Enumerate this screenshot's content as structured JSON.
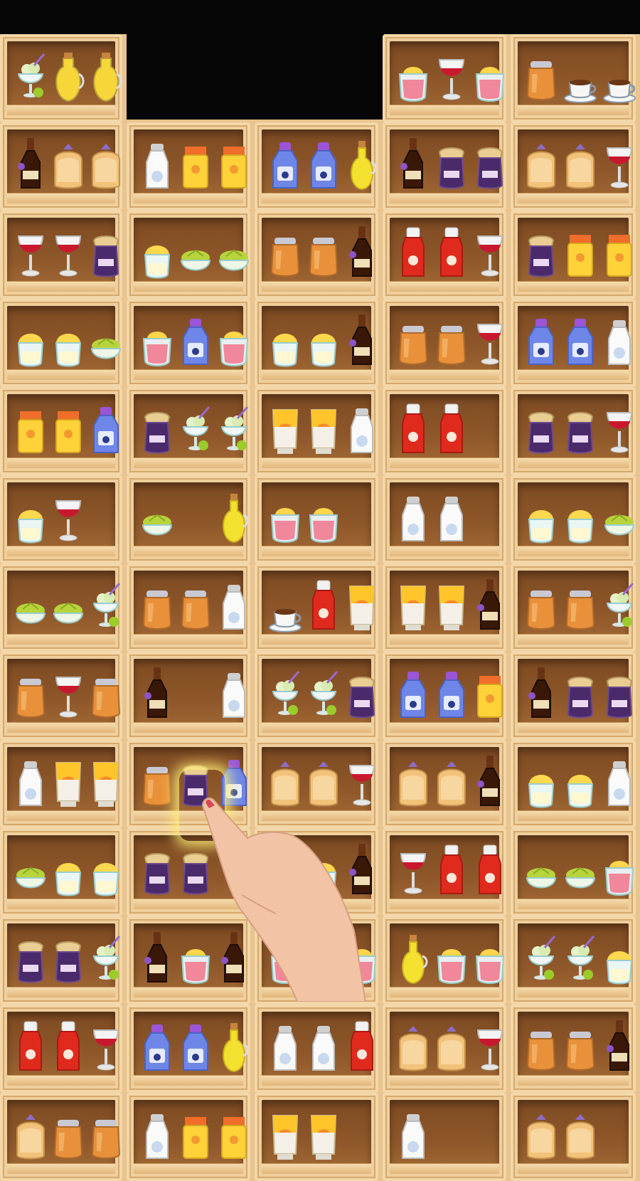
{
  "game": {
    "shelf_columns": 5,
    "item_types": [
      "lemon-cup-jar",
      "wine-glass",
      "juice-cruet",
      "coffee-cup",
      "honey-jar",
      "milk-bottle",
      "jam-jar",
      "bread-loaf",
      "orange-carton",
      "blue-bottle",
      "olive-oil-bottle",
      "lime-juicer",
      "pink-juice-jar",
      "soy-sauce-bottle",
      "ketchup-bottle",
      "sunscreen-tube",
      "ice-cream-sundae"
    ],
    "rows": [
      [
        [
          "ice-cream-sundae",
          "juice-cruet",
          "juice-cruet"
        ],
        null,
        null,
        [
          "pink-juice-jar",
          "wine-glass",
          "pink-juice-jar"
        ],
        [
          "honey-jar",
          "coffee-cup",
          "coffee-cup"
        ]
      ],
      [
        [
          "soy-sauce-bottle",
          "bread-loaf",
          "bread-loaf"
        ],
        [
          "milk-bottle",
          "orange-carton",
          "orange-carton"
        ],
        [
          "blue-bottle",
          "blue-bottle",
          "olive-oil-bottle"
        ],
        [
          "soy-sauce-bottle",
          "jam-jar",
          "jam-jar"
        ],
        [
          "bread-loaf",
          "bread-loaf",
          "wine-glass"
        ]
      ],
      [
        [
          "wine-glass",
          "wine-glass",
          "jam-jar"
        ],
        [
          "lemon-cup-jar",
          "lime-juicer",
          "lime-juicer"
        ],
        [
          "honey-jar",
          "honey-jar",
          "soy-sauce-bottle"
        ],
        [
          "ketchup-bottle",
          "ketchup-bottle",
          "wine-glass"
        ],
        [
          "jam-jar",
          "orange-carton",
          "orange-carton"
        ]
      ],
      [
        [
          "lemon-cup-jar",
          "lemon-cup-jar",
          "lime-juicer"
        ],
        [
          "pink-juice-jar",
          "blue-bottle",
          "pink-juice-jar"
        ],
        [
          "lemon-cup-jar",
          "lemon-cup-jar",
          "soy-sauce-bottle"
        ],
        [
          "honey-jar",
          "honey-jar",
          "wine-glass"
        ],
        [
          "blue-bottle",
          "blue-bottle",
          "milk-bottle"
        ]
      ],
      [
        [
          "orange-carton",
          "orange-carton",
          "blue-bottle"
        ],
        [
          "jam-jar",
          "ice-cream-sundae",
          "ice-cream-sundae"
        ],
        [
          "sunscreen-tube",
          "sunscreen-tube",
          "milk-bottle"
        ],
        [
          "ketchup-bottle",
          "ketchup-bottle",
          null
        ],
        [
          "jam-jar",
          "jam-jar",
          "wine-glass"
        ]
      ],
      [
        [
          "lemon-cup-jar",
          "wine-glass",
          null
        ],
        [
          "lime-juicer",
          null,
          "olive-oil-bottle"
        ],
        [
          "pink-juice-jar",
          "pink-juice-jar",
          null
        ],
        [
          "milk-bottle",
          "milk-bottle",
          null
        ],
        [
          "lemon-cup-jar",
          "lemon-cup-jar",
          "lime-juicer"
        ]
      ],
      [
        [
          "lime-juicer",
          "lime-juicer",
          "ice-cream-sundae"
        ],
        [
          "honey-jar",
          "honey-jar",
          "milk-bottle"
        ],
        [
          "coffee-cup",
          "ketchup-bottle",
          "sunscreen-tube"
        ],
        [
          "sunscreen-tube",
          "sunscreen-tube",
          "soy-sauce-bottle"
        ],
        [
          "honey-jar",
          "honey-jar",
          "ice-cream-sundae"
        ]
      ],
      [
        [
          "honey-jar",
          "wine-glass",
          "honey-jar"
        ],
        [
          "soy-sauce-bottle",
          null,
          "milk-bottle"
        ],
        [
          "ice-cream-sundae",
          "ice-cream-sundae",
          "jam-jar"
        ],
        [
          "blue-bottle",
          "blue-bottle",
          "orange-carton"
        ],
        [
          "soy-sauce-bottle",
          "jam-jar",
          "jam-jar"
        ]
      ],
      [
        [
          "milk-bottle",
          "sunscreen-tube",
          "sunscreen-tube"
        ],
        [
          "honey-jar",
          "jam-jar",
          "blue-bottle"
        ],
        [
          "bread-loaf",
          "bread-loaf",
          "wine-glass"
        ],
        [
          "bread-loaf",
          "bread-loaf",
          "soy-sauce-bottle"
        ],
        [
          "lemon-cup-jar",
          "lemon-cup-jar",
          "milk-bottle"
        ]
      ],
      [
        [
          "lime-juicer",
          "lemon-cup-jar",
          "lemon-cup-jar"
        ],
        [
          "jam-jar",
          "jam-jar",
          null
        ],
        [
          null,
          "lemon-cup-jar",
          "soy-sauce-bottle"
        ],
        [
          "wine-glass",
          "ketchup-bottle",
          "ketchup-bottle"
        ],
        [
          "lime-juicer",
          "lime-juicer",
          "pink-juice-jar"
        ]
      ],
      [
        [
          "jam-jar",
          "jam-jar",
          "ice-cream-sundae"
        ],
        [
          "soy-sauce-bottle",
          "pink-juice-jar",
          "soy-sauce-bottle"
        ],
        [
          "pink-juice-jar",
          "lemon-cup-jar",
          "pink-juice-jar"
        ],
        [
          "olive-oil-bottle",
          "pink-juice-jar",
          "pink-juice-jar"
        ],
        [
          "ice-cream-sundae",
          "ice-cream-sundae",
          "lemon-cup-jar"
        ]
      ],
      [
        [
          "ketchup-bottle",
          "ketchup-bottle",
          "wine-glass"
        ],
        [
          "blue-bottle",
          "blue-bottle",
          "olive-oil-bottle"
        ],
        [
          "milk-bottle",
          "milk-bottle",
          "ketchup-bottle"
        ],
        [
          "bread-loaf",
          "bread-loaf",
          "wine-glass"
        ],
        [
          "honey-jar",
          "honey-jar",
          "soy-sauce-bottle"
        ]
      ],
      [
        [
          "bread-loaf",
          "honey-jar",
          "honey-jar"
        ],
        [
          "milk-bottle",
          "orange-carton",
          "orange-carton"
        ],
        [
          "sunscreen-tube",
          "sunscreen-tube",
          null
        ],
        [
          "milk-bottle",
          null,
          null
        ],
        [
          "bread-loaf",
          "bread-loaf",
          null
        ]
      ]
    ],
    "selected_item": "jam-jar",
    "colors": {
      "shelf_frame": "#efcf9d",
      "shelf_back": "#8e572a",
      "highlight": "#fff078"
    }
  }
}
